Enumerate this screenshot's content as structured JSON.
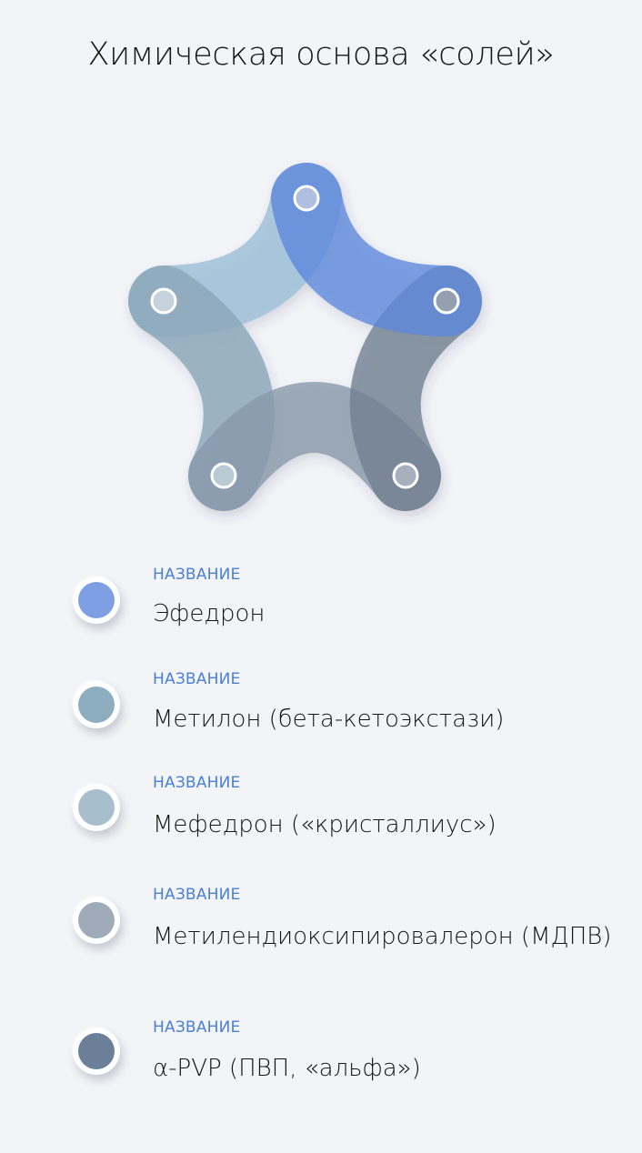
{
  "title": "Химическая основа «солей»",
  "colors": {
    "ephedrone": "#7e9fe3",
    "methylone": "#8caebf",
    "mephedrone": "#a7bfcc",
    "mdpv": "#9fabb9",
    "apvp": "#6b7f99",
    "caption": "#4a7fd6",
    "background": "#f3f4f8"
  },
  "legend": {
    "items": [
      {
        "caption": "НАЗВАНИЕ",
        "name": "Эфедрон",
        "color": "#7e9fe3"
      },
      {
        "caption": "НАЗВАНИЕ",
        "name": "Метилон  (бета-кетоэкстази)",
        "color": "#8caebf"
      },
      {
        "caption": "НАЗВАНИЕ",
        "name": "Мефедрон («кристаллиус»)",
        "color": "#a7bfcc"
      },
      {
        "caption": "НАЗВАНИЕ",
        "name": "Метилендиоксипировалерон (МДПВ)",
        "color": "#9fabb9"
      },
      {
        "caption": "НАЗВАНИЕ",
        "name": "α-PVP (ПВП, «альфа»)",
        "color": "#6b7f99"
      }
    ]
  }
}
